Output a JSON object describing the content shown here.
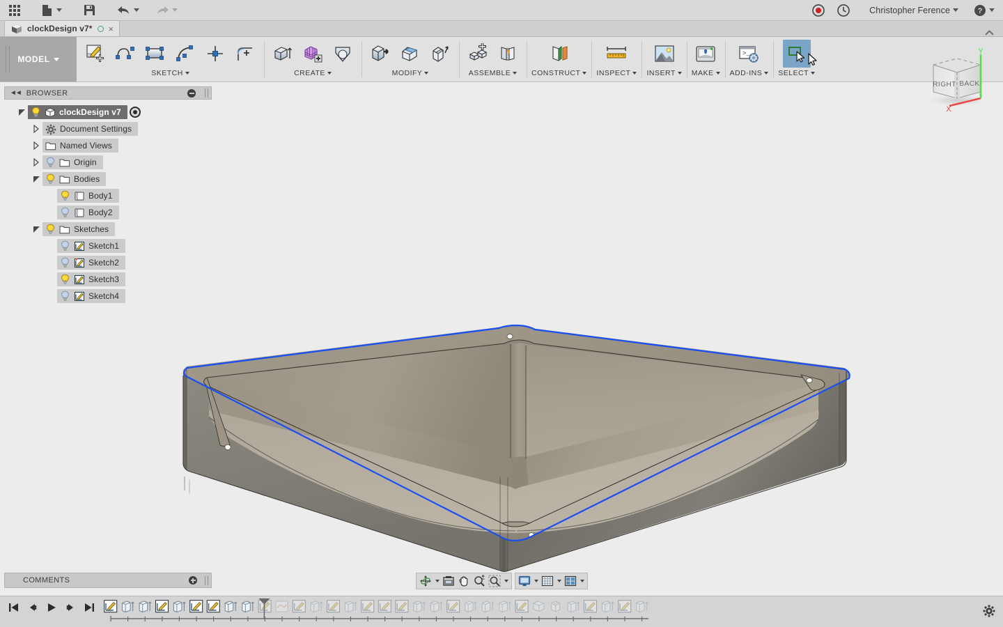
{
  "app": {
    "product": "Autodesk Fusion 360",
    "background_color": "#ececec",
    "accent_color": "#7ba4c9",
    "selection_edge_color": "#1a4ff5"
  },
  "quick_access": {
    "items": [
      {
        "name": "app-grid-icon",
        "label": "Show Data Panel"
      },
      {
        "name": "file-icon",
        "label": "File"
      },
      {
        "name": "save-icon",
        "label": "Save"
      },
      {
        "name": "undo-icon",
        "label": "Undo"
      },
      {
        "name": "redo-icon",
        "label": "Redo"
      }
    ],
    "record_label": "Record",
    "history_label": "Job Status",
    "user_name": "Christopher Ference",
    "help_label": "Help"
  },
  "tab_bar": {
    "document_title": "clockDesign v7*",
    "close_label": "×",
    "collapse_label": "Collapse Toolbar"
  },
  "ribbon": {
    "workspace_label": "MODEL",
    "panels": [
      {
        "label": "SKETCH",
        "tools": [
          {
            "name": "create-sketch-icon",
            "label": "Create Sketch"
          },
          {
            "name": "line-icon",
            "label": "Line"
          },
          {
            "name": "rectangle-icon",
            "label": "Rectangle"
          },
          {
            "name": "arc-icon",
            "label": "Arc"
          },
          {
            "name": "dimension-icon",
            "label": "Sketch Dimension"
          },
          {
            "name": "fillet-icon",
            "label": "Fillet"
          }
        ]
      },
      {
        "label": "CREATE",
        "tools": [
          {
            "name": "extrude-icon",
            "label": "Extrude"
          },
          {
            "name": "pattern-icon",
            "label": "Pattern"
          },
          {
            "name": "loft-icon",
            "label": "Loft"
          }
        ]
      },
      {
        "label": "MODIFY",
        "tools": [
          {
            "name": "press-pull-icon",
            "label": "Press Pull"
          },
          {
            "name": "fillet-3d-icon",
            "label": "Fillet"
          },
          {
            "name": "shell-icon",
            "label": "Shell"
          }
        ]
      },
      {
        "label": "ASSEMBLE",
        "tools": [
          {
            "name": "new-component-icon",
            "label": "New Component"
          },
          {
            "name": "joint-icon",
            "label": "Joint"
          }
        ]
      },
      {
        "label": "CONSTRUCT",
        "tools": [
          {
            "name": "offset-plane-icon",
            "label": "Offset Plane"
          }
        ]
      },
      {
        "label": "INSPECT",
        "tools": [
          {
            "name": "measure-icon",
            "label": "Measure"
          }
        ]
      },
      {
        "label": "INSERT",
        "tools": [
          {
            "name": "insert-image-icon",
            "label": "Insert Image"
          }
        ]
      },
      {
        "label": "MAKE",
        "tools": [
          {
            "name": "3d-print-icon",
            "label": "3D Print"
          }
        ]
      },
      {
        "label": "ADD-INS",
        "tools": [
          {
            "name": "scripts-addins-icon",
            "label": "Scripts and Add-Ins"
          }
        ]
      },
      {
        "label": "SELECT",
        "selected": true,
        "tools": [
          {
            "name": "select-icon",
            "label": "Select"
          }
        ]
      }
    ]
  },
  "browser": {
    "header": "BROWSER",
    "collapse_label": "Collapse",
    "tree": [
      {
        "label": "clockDesign v7",
        "depth": 0,
        "twist": "down",
        "bulb": "on",
        "icon": "component-icon",
        "active": true,
        "target": true
      },
      {
        "label": "Document Settings",
        "depth": 1,
        "twist": "right",
        "bulb": "none",
        "icon": "gear-icon"
      },
      {
        "label": "Named Views",
        "depth": 1,
        "twist": "right",
        "bulb": "none",
        "icon": "folder-icon"
      },
      {
        "label": "Origin",
        "depth": 1,
        "twist": "right",
        "bulb": "off",
        "icon": "folder-icon"
      },
      {
        "label": "Bodies",
        "depth": 1,
        "twist": "down",
        "bulb": "on",
        "icon": "folder-icon"
      },
      {
        "label": "Body1",
        "depth": 2,
        "twist": "none",
        "bulb": "on",
        "icon": "body-icon"
      },
      {
        "label": "Body2",
        "depth": 2,
        "twist": "none",
        "bulb": "off",
        "icon": "body-icon"
      },
      {
        "label": "Sketches",
        "depth": 1,
        "twist": "down",
        "bulb": "on",
        "icon": "folder-icon"
      },
      {
        "label": "Sketch1",
        "depth": 2,
        "twist": "none",
        "bulb": "off",
        "icon": "sketch-icon"
      },
      {
        "label": "Sketch2",
        "depth": 2,
        "twist": "none",
        "bulb": "off",
        "icon": "sketch-warning-icon"
      },
      {
        "label": "Sketch3",
        "depth": 2,
        "twist": "none",
        "bulb": "on",
        "icon": "sketch-icon"
      },
      {
        "label": "Sketch4",
        "depth": 2,
        "twist": "none",
        "bulb": "off",
        "icon": "sketch-icon"
      }
    ]
  },
  "comments": {
    "header": "COMMENTS",
    "add_label": "Add Comment"
  },
  "viewcube": {
    "face_left": "RIGHT",
    "face_right": "BACK",
    "axis_x": "X",
    "axis_y": "Y",
    "axis_x_color": "#e8484a",
    "axis_y_color": "#4fe04f"
  },
  "navbar": {
    "group1": [
      {
        "name": "orbit-icon",
        "label": "Orbit",
        "caret": true
      },
      {
        "name": "look-at-icon",
        "label": "Look At",
        "caret": false
      },
      {
        "name": "pan-icon",
        "label": "Pan",
        "caret": false
      },
      {
        "name": "zoom-icon",
        "label": "Zoom",
        "caret": false
      },
      {
        "name": "zoom-window-icon",
        "label": "Fit",
        "caret": true
      }
    ],
    "group2": [
      {
        "name": "display-settings-icon",
        "label": "Display Settings",
        "caret": true
      },
      {
        "name": "grid-snaps-icon",
        "label": "Grid and Snaps",
        "caret": true
      },
      {
        "name": "viewports-icon",
        "label": "Viewports",
        "caret": true
      }
    ]
  },
  "timeline": {
    "controls": [
      {
        "name": "timeline-begin-icon",
        "label": "Go to Beginning"
      },
      {
        "name": "timeline-step-back-icon",
        "label": "Step Back"
      },
      {
        "name": "timeline-play-icon",
        "label": "Play"
      },
      {
        "name": "timeline-step-forward-icon",
        "label": "Step Forward"
      },
      {
        "name": "timeline-end-icon",
        "label": "Go to End"
      }
    ],
    "settings_label": "Timeline Settings",
    "marker_index": 9,
    "features": [
      {
        "type": "sketch",
        "active": true
      },
      {
        "type": "extrude",
        "active": true
      },
      {
        "type": "extrude",
        "active": true
      },
      {
        "type": "sketch",
        "active": true
      },
      {
        "type": "extrude",
        "active": true
      },
      {
        "type": "sketch",
        "active": true
      },
      {
        "type": "sketch",
        "active": true
      },
      {
        "type": "extrude",
        "active": true
      },
      {
        "type": "extrude",
        "active": true
      },
      {
        "type": "sketch",
        "active": false
      },
      {
        "type": "revolve",
        "active": false
      },
      {
        "type": "sketch",
        "active": false
      },
      {
        "type": "extrude",
        "active": false
      },
      {
        "type": "sketch",
        "active": false
      },
      {
        "type": "extrude",
        "active": false
      },
      {
        "type": "sketch",
        "active": false
      },
      {
        "type": "sketch",
        "active": false
      },
      {
        "type": "sketch",
        "active": false
      },
      {
        "type": "extrude",
        "active": false
      },
      {
        "type": "extrude",
        "active": false
      },
      {
        "type": "sketch",
        "active": false
      },
      {
        "type": "extrude",
        "active": false
      },
      {
        "type": "extrude",
        "active": false
      },
      {
        "type": "extrude",
        "active": false
      },
      {
        "type": "sketch",
        "active": false
      },
      {
        "type": "fillet",
        "active": false
      },
      {
        "type": "shell",
        "active": false
      },
      {
        "type": "extrude",
        "active": false
      },
      {
        "type": "sketch",
        "active": false
      },
      {
        "type": "extrude",
        "active": false
      },
      {
        "type": "sketch",
        "active": false
      },
      {
        "type": "extrude",
        "active": false
      }
    ]
  },
  "model": {
    "description": "Rounded rectangular open-top box / tray, shelled, shown in isometric view",
    "exterior_color": "#807d75",
    "interior_color": "#aaa496",
    "rim_color": "#9a9384",
    "highlight_edge_color": "#1a4ff5"
  }
}
